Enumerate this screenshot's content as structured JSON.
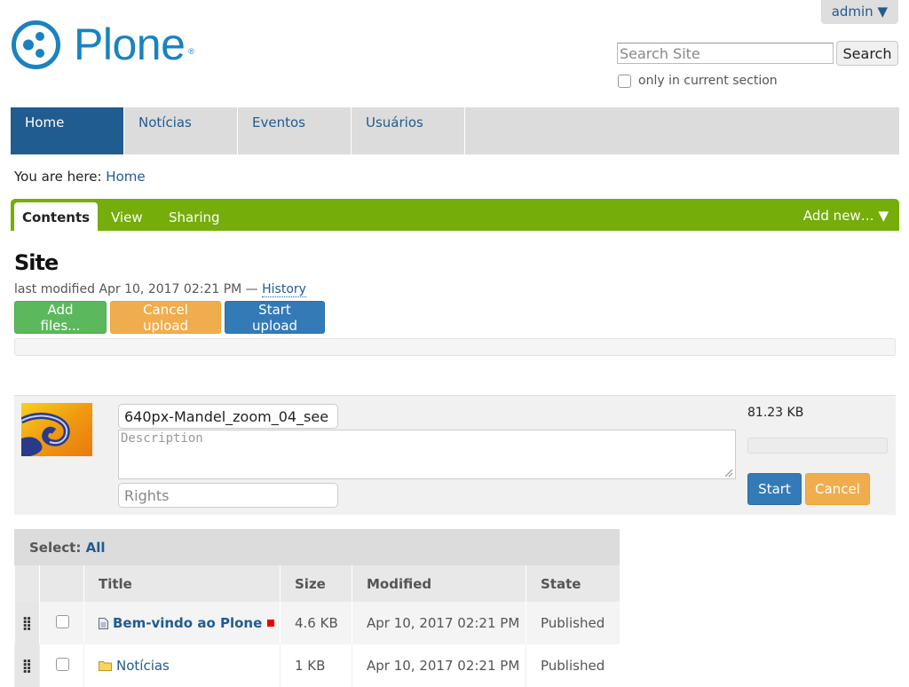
{
  "header": {
    "logo_text": "Plone",
    "user_menu": "admin ▼",
    "search_placeholder": "Search Site",
    "search_button": "Search",
    "search_option": "only in current section"
  },
  "nav": {
    "items": [
      {
        "label": "Home"
      },
      {
        "label": "Notícias"
      },
      {
        "label": "Eventos"
      },
      {
        "label": "Usuários"
      }
    ]
  },
  "breadcrumb": {
    "prefix": "You are here:",
    "current": "Home"
  },
  "toolbar": {
    "tabs": [
      {
        "label": "Contents"
      },
      {
        "label": "View"
      },
      {
        "label": "Sharing"
      }
    ],
    "add_new": "Add new… ▼"
  },
  "page": {
    "title": "Site",
    "modified_text": "last modified Apr 10, 2017 02:21 PM —",
    "history_link": "History"
  },
  "upload": {
    "add_files": "Add files...",
    "cancel_upload": "Cancel upload",
    "start_upload": "Start upload",
    "file": {
      "name": "640px-Mandel_zoom_04_see",
      "description_placeholder": "Description",
      "rights_placeholder": "Rights",
      "size": "81.23 KB",
      "start": "Start",
      "cancel": "Cancel"
    }
  },
  "listing": {
    "select_label": "Select:",
    "select_all": "All",
    "columns": [
      "Title",
      "Size",
      "Modified",
      "State"
    ],
    "rows": [
      {
        "title": "Bem-vindo ao Plone",
        "size": "4.6 KB",
        "modified": "Apr 10, 2017 02:21 PM",
        "state": "Published"
      },
      {
        "title": "Notícias",
        "size": "1 KB",
        "modified": "Apr 10, 2017 02:21 PM",
        "state": "Published"
      }
    ]
  },
  "colors": {
    "brand": "#1a82c0",
    "nav_active": "#205c90",
    "toolbar": "#75ad0a",
    "btn_green": "#5cb85c",
    "btn_orange": "#f0ad4e",
    "btn_blue": "#337ab7"
  }
}
